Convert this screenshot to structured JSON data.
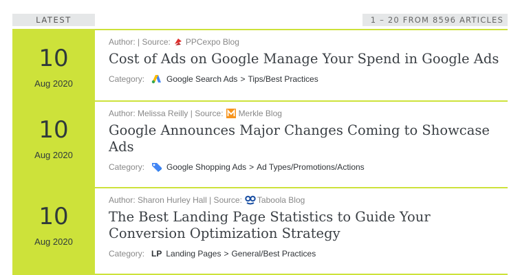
{
  "header": {
    "latest_label": "LATEST",
    "count_label": "1 – 20 FROM 8596 ARTICLES"
  },
  "articles": [
    {
      "day": "10",
      "month": "Aug 2020",
      "author_prefix": "Author:",
      "author": "",
      "source_prefix": "| Source:",
      "source": "PPCexpo Blog",
      "source_icon": "ppcexpo-logo-icon",
      "title": "Cost of Ads on Google Manage Your Spend in Google Ads",
      "category_label": "Category:",
      "category_icon": "google-ads-icon",
      "category": "Google Search Ads",
      "sep": ">",
      "subcategory": "Tips/Best Practices"
    },
    {
      "day": "10",
      "month": "Aug 2020",
      "author_prefix": "Author:",
      "author": "Melissa Reilly",
      "source_prefix": "| Source:",
      "source": "Merkle Blog",
      "source_icon": "merkle-logo-icon",
      "title": "Google Announces Major Changes Coming to Showcase Ads",
      "category_label": "Category:",
      "category_icon": "shopping-tag-icon",
      "category": "Google Shopping Ads",
      "sep": ">",
      "subcategory": "Ad Types/Promotions/Actions"
    },
    {
      "day": "10",
      "month": "Aug 2020",
      "author_prefix": "Author:",
      "author": "Sharon Hurley Hall",
      "source_prefix": "| Source:",
      "source": "Taboola Blog",
      "source_icon": "taboola-logo-icon",
      "title": "The Best Landing Page Statistics to Guide Your Conversion Optimization Strategy",
      "category_label": "Category:",
      "category_icon_text": "LP",
      "category": "Landing Pages",
      "sep": ">",
      "subcategory": "General/Best Practices"
    }
  ],
  "colors": {
    "accent": "#cde23a",
    "tab_bg": "#e5e7e8",
    "title": "#3a3f44",
    "muted": "#888888"
  }
}
